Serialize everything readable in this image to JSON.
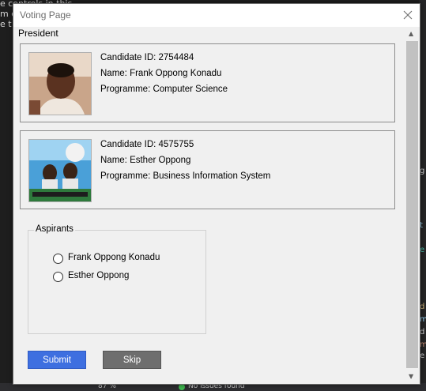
{
  "background": {
    "fragment_line1": "e controls in this",
    "fragment_line2": "m c",
    "fragment_line3": "e t",
    "status_zoom": "87 %",
    "status_issues": "No issues found",
    "right_glyphs": [
      "g",
      "t",
      "e",
      "d",
      "m",
      "d",
      "m",
      "e"
    ]
  },
  "window": {
    "title": "Voting Page",
    "group_title": "President"
  },
  "candidates": [
    {
      "id_text": "Candidate ID: 2754484",
      "name_text": "Name: Frank Oppong Konadu",
      "programme_text": "Programme: Computer Science"
    },
    {
      "id_text": "Candidate ID: 4575755",
      "name_text": "Name: Esther Oppong",
      "programme_text": "Programme: Business Information System"
    }
  ],
  "aspirants": {
    "legend": "Aspirants",
    "options": [
      "Frank Oppong Konadu",
      "Esther Oppong"
    ]
  },
  "buttons": {
    "submit": "Submit",
    "skip": "Skip"
  },
  "colors": {
    "submit_bg": "#3e6fe0",
    "skip_bg": "#6e6e6e"
  }
}
